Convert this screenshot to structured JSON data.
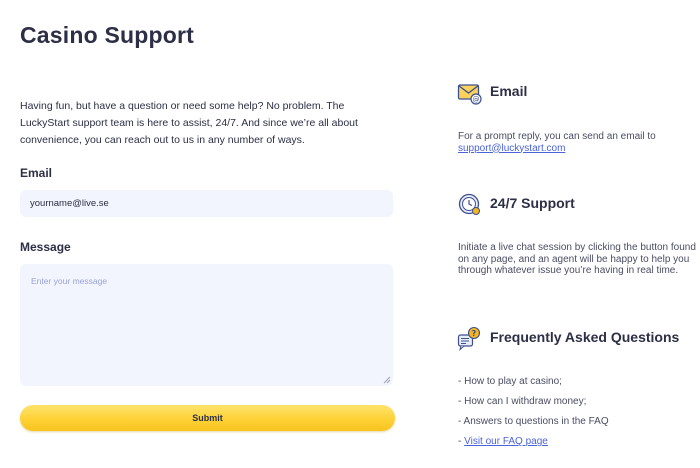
{
  "page": {
    "title": "Casino Support",
    "intro": "Having fun, but have a question or need some help? No problem. The LuckyStart support team is here to assist, 24/7. And since we’re all about convenience, you can reach out to us in any number of ways."
  },
  "form": {
    "email_label": "Email",
    "email_value": "yourname@live.se",
    "message_label": "Message",
    "message_placeholder": "Enter your message",
    "submit_label": "Submit"
  },
  "sections": {
    "email": {
      "title": "Email",
      "text": "For a prompt reply, you can send an email to",
      "link": "support@luckystart.com",
      "icon": "envelope-icon"
    },
    "support": {
      "title": "24/7 Support",
      "text": "Initiate a live chat session by clicking the button found on any page, and an agent will be happy to help you through whatever issue you’re having in real time.",
      "icon": "clock-icon"
    },
    "faq": {
      "title": "Frequently Asked Questions",
      "icon": "question-chat-icon",
      "items": [
        "- How to play at casino;",
        "- How can I withdraw money;",
        "- Answers to questions in the FAQ"
      ],
      "link_prefix": "- ",
      "link": "Visit our FAQ page"
    }
  },
  "colors": {
    "text": "#2c2f45",
    "input_bg": "#f2f5fd",
    "button": "#fed235",
    "link": "#4b63d8",
    "icon_accent": "#f5b51e",
    "icon_blue": "#3c4f8f"
  }
}
